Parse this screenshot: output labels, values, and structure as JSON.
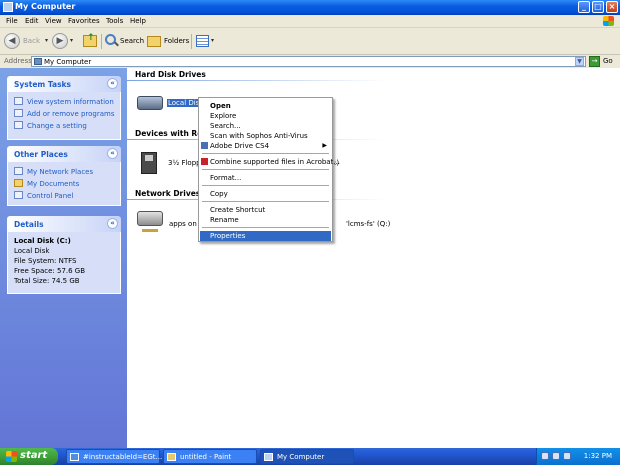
{
  "window": {
    "title": "My Computer"
  },
  "menubar": {
    "items": [
      "File",
      "Edit",
      "View",
      "Favorites",
      "Tools",
      "Help"
    ]
  },
  "toolbar": {
    "back": "Back",
    "search": "Search",
    "folders": "Folders"
  },
  "address": {
    "label": "Address",
    "value": "My Computer",
    "go": "Go"
  },
  "sidebar": {
    "system_tasks": {
      "title": "System Tasks",
      "items": [
        "View system information",
        "Add or remove programs",
        "Change a setting"
      ]
    },
    "other_places": {
      "title": "Other Places",
      "items": [
        "My Network Places",
        "My Documents",
        "Control Panel"
      ]
    },
    "details": {
      "title": "Details",
      "name": "Local Disk (C:)",
      "type": "Local Disk",
      "filesystem": "File System: NTFS",
      "free": "Free Space: 57.6 GB",
      "total": "Total Size: 74.5 GB"
    }
  },
  "main": {
    "groups": {
      "hdd": "Hard Disk Drives",
      "removable": "Devices with Removable Storage",
      "network": "Network Drives"
    },
    "drives": {
      "local": "Local Disk",
      "floppy_left": "3½ Floppy",
      "floppy_right": ":)",
      "net_left": "apps on 'lc",
      "net_right": "'lcms-fs' (Q:)"
    }
  },
  "context_menu": {
    "items": [
      "Open",
      "Explore",
      "Search...",
      "Scan with Sophos Anti-Virus",
      "Adobe Drive CS4",
      "Combine supported files in Acrobat...",
      "Format...",
      "Copy",
      "Create Shortcut",
      "Rename",
      "Properties"
    ]
  },
  "taskbar": {
    "start": "start",
    "tasks": [
      "#instructableId=EGt...",
      "untitled - Paint",
      "My Computer"
    ],
    "clock": "1:32 PM"
  },
  "colors": {
    "xp_blue": "#0451d9",
    "selection": "#316ac5",
    "start_green": "#3c9b37"
  }
}
